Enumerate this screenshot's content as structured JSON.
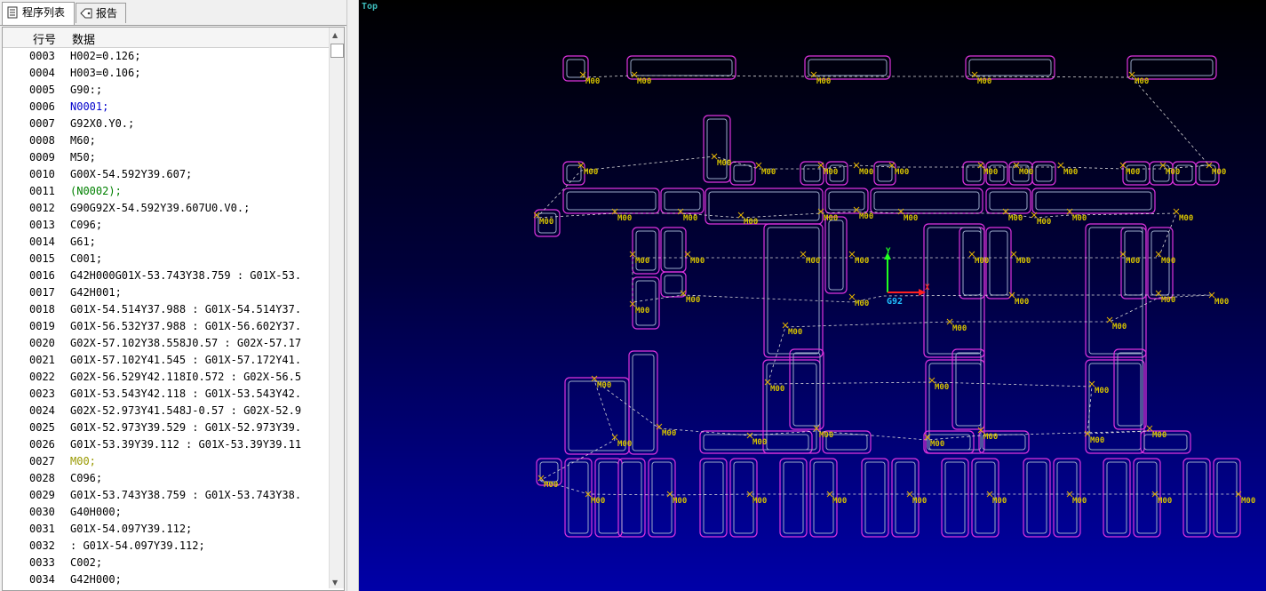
{
  "tabs": [
    {
      "label": "程序列表",
      "active": true
    },
    {
      "label": "报告",
      "active": false
    }
  ],
  "table": {
    "columns": [
      "行号",
      "数据"
    ],
    "rows": [
      {
        "ln": "0003",
        "data": "H002=0.126;",
        "color": "#000000"
      },
      {
        "ln": "0004",
        "data": "H003=0.106;",
        "color": "#000000"
      },
      {
        "ln": "0005",
        "data": "G90:;",
        "color": "#000000"
      },
      {
        "ln": "0006",
        "data": "N0001;",
        "color": "#0000cc"
      },
      {
        "ln": "0007",
        "data": "G92X0.Y0.;",
        "color": "#000000"
      },
      {
        "ln": "0008",
        "data": "M60;",
        "color": "#000000"
      },
      {
        "ln": "0009",
        "data": "M50;",
        "color": "#000000"
      },
      {
        "ln": "0010",
        "data": "G00X-54.592Y39.607;",
        "color": "#000000"
      },
      {
        "ln": "0011",
        "data": "(N0002);",
        "color": "#008000"
      },
      {
        "ln": "0012",
        "data": "G90G92X-54.592Y39.607U0.V0.;",
        "color": "#000000"
      },
      {
        "ln": "0013",
        "data": "C096;",
        "color": "#000000"
      },
      {
        "ln": "0014",
        "data": "G61;",
        "color": "#000000"
      },
      {
        "ln": "0015",
        "data": "C001;",
        "color": "#000000"
      },
      {
        "ln": "0016",
        "data": "G42H000G01X-53.743Y38.759 : G01X-53.",
        "color": "#000000"
      },
      {
        "ln": "0017",
        "data": "G42H001;",
        "color": "#000000"
      },
      {
        "ln": "0018",
        "data": "G01X-54.514Y37.988 : G01X-54.514Y37.",
        "color": "#000000"
      },
      {
        "ln": "0019",
        "data": "G01X-56.532Y37.988 : G01X-56.602Y37.",
        "color": "#000000"
      },
      {
        "ln": "0020",
        "data": "G02X-57.102Y38.558J0.57 : G02X-57.17",
        "color": "#000000"
      },
      {
        "ln": "0021",
        "data": "G01X-57.102Y41.545 : G01X-57.172Y41.",
        "color": "#000000"
      },
      {
        "ln": "0022",
        "data": "G02X-56.529Y42.118I0.572 : G02X-56.5",
        "color": "#000000"
      },
      {
        "ln": "0023",
        "data": "G01X-53.543Y42.118 : G01X-53.543Y42.",
        "color": "#000000"
      },
      {
        "ln": "0024",
        "data": "G02X-52.973Y41.548J-0.57 : G02X-52.9",
        "color": "#000000"
      },
      {
        "ln": "0025",
        "data": "G01X-52.973Y39.529 : G01X-52.973Y39.",
        "color": "#000000"
      },
      {
        "ln": "0026",
        "data": "G01X-53.39Y39.112 : G01X-53.39Y39.11",
        "color": "#000000"
      },
      {
        "ln": "0027",
        "data": "M00;",
        "color": "#999900"
      },
      {
        "ln": "0028",
        "data": "C096;",
        "color": "#000000"
      },
      {
        "ln": "0029",
        "data": "G01X-53.743Y38.759 : G01X-53.743Y38.",
        "color": "#000000"
      },
      {
        "ln": "0030",
        "data": "G40H000;",
        "color": "#000000"
      },
      {
        "ln": "0031",
        "data": "G01X-54.097Y39.112;",
        "color": "#000000"
      },
      {
        "ln": "0032",
        "data": " : G01X-54.097Y39.112;",
        "color": "#000000"
      },
      {
        "ln": "0033",
        "data": "C002;",
        "color": "#000000"
      },
      {
        "ln": "0034",
        "data": "G42H000;",
        "color": "#000000"
      }
    ]
  },
  "viewport": {
    "view_label": "Top",
    "axis_y": "Y",
    "axis_x": "X",
    "origin_label": "G92",
    "marker_label": "M00",
    "colors": {
      "outline": "#dd33dd",
      "inner": "#9aa8c8",
      "path": "#d8d8d8",
      "marker": "#e0b000",
      "label": "#d4c000",
      "axis_x": "#ff2020",
      "axis_y": "#20ff20"
    }
  }
}
